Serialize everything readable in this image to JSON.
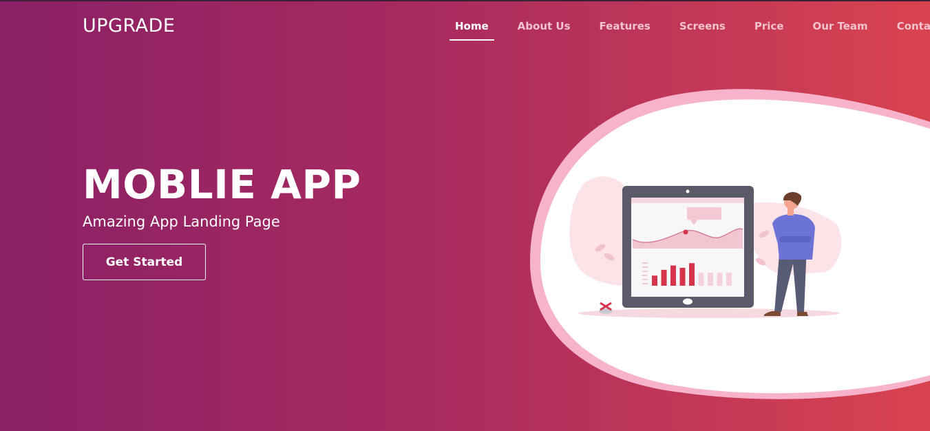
{
  "brand": "UPGRADE",
  "nav": {
    "items": [
      {
        "label": "Home",
        "active": true
      },
      {
        "label": "About Us"
      },
      {
        "label": "Features"
      },
      {
        "label": "Screens"
      },
      {
        "label": "Price"
      },
      {
        "label": "Our Team"
      },
      {
        "label": "Contact"
      }
    ]
  },
  "hero": {
    "title": "MOBLIE APP",
    "subtitle": "Amazing App Landing Page",
    "cta_label": "Get Started"
  },
  "illustration": {
    "icon": "tablet-analytics-person-illustration",
    "bar_values_highlighted": [
      0.35,
      0.55,
      0.7,
      0.62,
      0.78
    ],
    "bar_values_faded": [
      0.45,
      0.45,
      0.45,
      0.45
    ]
  },
  "colors": {
    "gradient_start": "#8a2066",
    "gradient_end": "#d9434f",
    "accent": "#d6344b",
    "blob_outline": "#f7b3cb"
  }
}
